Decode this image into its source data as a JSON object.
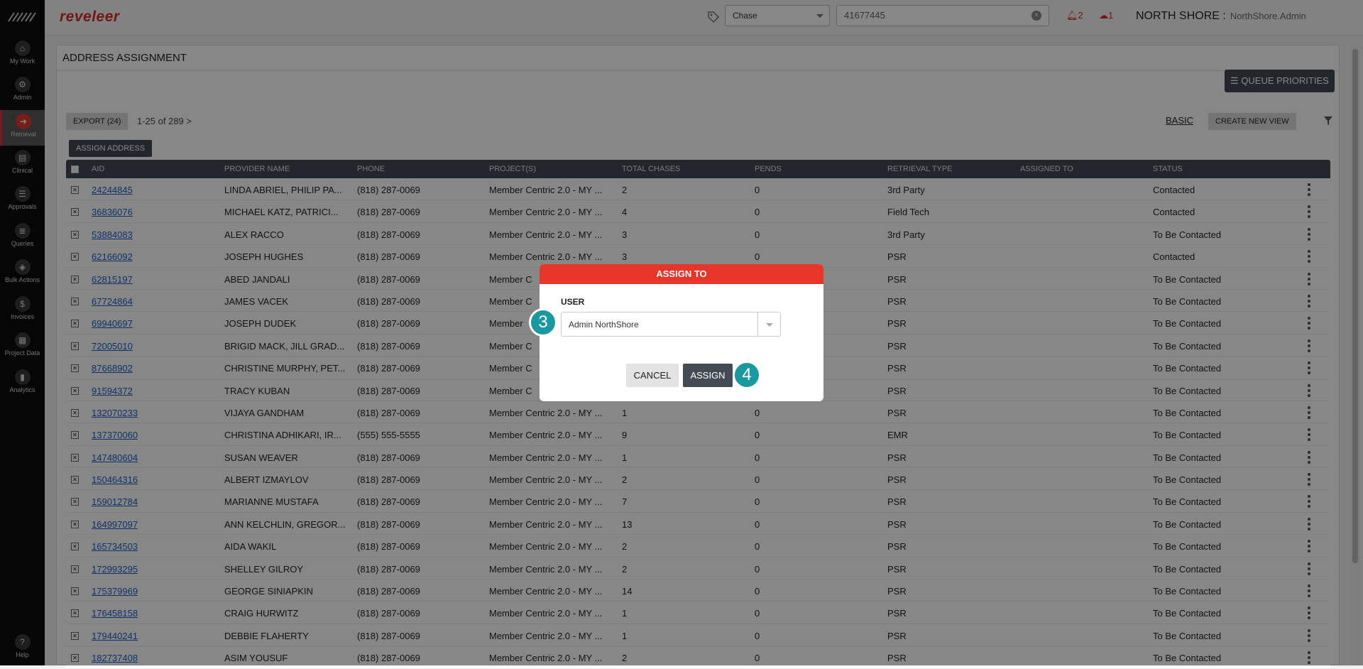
{
  "app": {
    "brand": "reveleer"
  },
  "sidebar": {
    "items": [
      {
        "label": "My Work",
        "icon": "home-icon"
      },
      {
        "label": "Admin",
        "icon": "gear-icon"
      },
      {
        "label": "Retrieval",
        "icon": "arrow-right-icon"
      },
      {
        "label": "Clinical",
        "icon": "document-icon"
      },
      {
        "label": "Approvals",
        "icon": "checklist-icon"
      },
      {
        "label": "Queries",
        "icon": "list-icon"
      },
      {
        "label": "Bulk Actions",
        "icon": "layers-icon"
      },
      {
        "label": "Invoices",
        "icon": "dollar-icon"
      },
      {
        "label": "Project Data",
        "icon": "grid-icon"
      },
      {
        "label": "Analytics",
        "icon": "bar-chart-icon"
      }
    ],
    "help": "Help"
  },
  "header": {
    "search_type": "Chase",
    "search_value": "41677445",
    "alerts_count": "2",
    "cloud_count": "1",
    "org": "NORTH SHORE :",
    "user": "NorthShore.Admin"
  },
  "page": {
    "title": "ADDRESS ASSIGNMENT",
    "queue_priorities": "QUEUE PRIORITIES",
    "export": "EXPORT (24)",
    "pager": "1-25  of  289 >",
    "basic": "BASIC",
    "create_view": "CREATE NEW VIEW",
    "assign_address": "ASSIGN ADDRESS"
  },
  "table": {
    "columns": [
      "AID",
      "PROVIDER NAME",
      "PHONE",
      "PROJECT(S)",
      "TOTAL CHASES",
      "PENDS",
      "RETRIEVAL TYPE",
      "ASSIGNED TO",
      "STATUS"
    ],
    "rows": [
      {
        "aid": "24244845",
        "name": "LINDA ABRIEL, PHILIP PA...",
        "phone": "(818) 287-0069",
        "project": "Member Centric 2.0 - MY ...",
        "chases": "2",
        "pends": "0",
        "type": "3rd Party",
        "assigned": "",
        "status": "Contacted"
      },
      {
        "aid": "36836076",
        "name": "MICHAEL KATZ, PATRICI...",
        "phone": "(818) 287-0069",
        "project": "Member Centric 2.0 - MY ...",
        "chases": "4",
        "pends": "0",
        "type": "Field Tech",
        "assigned": "",
        "status": "Contacted"
      },
      {
        "aid": "53884083",
        "name": "ALEX RACCO",
        "phone": "(818) 287-0069",
        "project": "Member Centric 2.0 - MY ...",
        "chases": "3",
        "pends": "0",
        "type": "3rd Party",
        "assigned": "",
        "status": "To Be Contacted"
      },
      {
        "aid": "62166092",
        "name": "JOSEPH HUGHES",
        "phone": "(818) 287-0069",
        "project": "Member Centric 2.0 - MY ...",
        "chases": "3",
        "pends": "0",
        "type": "PSR",
        "assigned": "",
        "status": "Contacted"
      },
      {
        "aid": "62815197",
        "name": "ABED JANDALI",
        "phone": "(818) 287-0069",
        "project": "Member C",
        "chases": "",
        "pends": "",
        "type": "PSR",
        "assigned": "",
        "status": "To Be Contacted"
      },
      {
        "aid": "67724864",
        "name": "JAMES VACEK",
        "phone": "(818) 287-0069",
        "project": "Member C",
        "chases": "",
        "pends": "",
        "type": "PSR",
        "assigned": "",
        "status": "To Be Contacted"
      },
      {
        "aid": "69940697",
        "name": "JOSEPH DUDEK",
        "phone": "(818) 287-0069",
        "project": "Member",
        "chases": "",
        "pends": "",
        "type": "PSR",
        "assigned": "",
        "status": "To Be Contacted"
      },
      {
        "aid": "72005010",
        "name": "BRIGID MACK, JILL GRAD...",
        "phone": "(818) 287-0069",
        "project": "Member C",
        "chases": "",
        "pends": "",
        "type": "PSR",
        "assigned": "",
        "status": "To Be Contacted"
      },
      {
        "aid": "87668902",
        "name": "CHRISTINE MURPHY, PET...",
        "phone": "(818) 287-0069",
        "project": "Member C",
        "chases": "",
        "pends": "",
        "type": "PSR",
        "assigned": "",
        "status": "To Be Contacted"
      },
      {
        "aid": "91594372",
        "name": "TRACY KUBAN",
        "phone": "(818) 287-0069",
        "project": "Member C",
        "chases": "",
        "pends": "",
        "type": "PSR",
        "assigned": "",
        "status": "To Be Contacted"
      },
      {
        "aid": "132070233",
        "name": "VIJAYA GANDHAM",
        "phone": "(818) 287-0069",
        "project": "Member Centric 2.0 - MY ...",
        "chases": "1",
        "pends": "0",
        "type": "PSR",
        "assigned": "",
        "status": "To Be Contacted"
      },
      {
        "aid": "137370060",
        "name": "CHRISTINA ADHIKARI, IR...",
        "phone": "(555) 555-5555",
        "project": "Member Centric 2.0 - MY ...",
        "chases": "9",
        "pends": "0",
        "type": "EMR",
        "assigned": "",
        "status": "To Be Contacted"
      },
      {
        "aid": "147480604",
        "name": "SUSAN WEAVER",
        "phone": "(818) 287-0069",
        "project": "Member Centric 2.0 - MY ...",
        "chases": "1",
        "pends": "0",
        "type": "PSR",
        "assigned": "",
        "status": "To Be Contacted"
      },
      {
        "aid": "150464316",
        "name": "ALBERT IZMAYLOV",
        "phone": "(818) 287-0069",
        "project": "Member Centric 2.0 - MY ...",
        "chases": "2",
        "pends": "0",
        "type": "PSR",
        "assigned": "",
        "status": "To Be Contacted"
      },
      {
        "aid": "159012784",
        "name": "MARIANNE MUSTAFA",
        "phone": "(818) 287-0069",
        "project": "Member Centric 2.0 - MY ...",
        "chases": "7",
        "pends": "0",
        "type": "PSR",
        "assigned": "",
        "status": "To Be Contacted"
      },
      {
        "aid": "164997097",
        "name": "ANN KELCHLIN, GREGOR...",
        "phone": "(818) 287-0069",
        "project": "Member Centric 2.0 - MY ...",
        "chases": "13",
        "pends": "0",
        "type": "PSR",
        "assigned": "",
        "status": "To Be Contacted"
      },
      {
        "aid": "165734503",
        "name": "AIDA WAKIL",
        "phone": "(818) 287-0069",
        "project": "Member Centric 2.0 - MY ...",
        "chases": "2",
        "pends": "0",
        "type": "PSR",
        "assigned": "",
        "status": "To Be Contacted"
      },
      {
        "aid": "172993295",
        "name": "SHELLEY GILROY",
        "phone": "(818) 287-0069",
        "project": "Member Centric 2.0 - MY ...",
        "chases": "2",
        "pends": "0",
        "type": "PSR",
        "assigned": "",
        "status": "To Be Contacted"
      },
      {
        "aid": "175379969",
        "name": "GEORGE SINIAPKIN",
        "phone": "(818) 287-0069",
        "project": "Member Centric 2.0 - MY ...",
        "chases": "14",
        "pends": "0",
        "type": "PSR",
        "assigned": "",
        "status": "To Be Contacted"
      },
      {
        "aid": "176458158",
        "name": "CRAIG HURWITZ",
        "phone": "(818) 287-0069",
        "project": "Member Centric 2.0 - MY ...",
        "chases": "1",
        "pends": "0",
        "type": "PSR",
        "assigned": "",
        "status": "To Be Contacted"
      },
      {
        "aid": "179440241",
        "name": "DEBBIE FLAHERTY",
        "phone": "(818) 287-0069",
        "project": "Member Centric 2.0 - MY ...",
        "chases": "1",
        "pends": "0",
        "type": "PSR",
        "assigned": "",
        "status": "To Be Contacted"
      },
      {
        "aid": "182737408",
        "name": "ASIM YOUSUF",
        "phone": "(818) 287-0069",
        "project": "Member Centric 2.0 - MY ...",
        "chases": "2",
        "pends": "0",
        "type": "PSR",
        "assigned": "",
        "status": "To Be Contacted"
      }
    ]
  },
  "modal": {
    "title": "ASSIGN TO",
    "user_label": "USER",
    "user_value": "Admin NorthShore",
    "cancel": "CANCEL",
    "assign": "ASSIGN"
  },
  "steps": {
    "select": "3",
    "assign": "4"
  },
  "colors": {
    "accent": "#e8352a",
    "dark": "#434b55",
    "step": "#1a9aa0",
    "link": "#1a5fc7"
  }
}
